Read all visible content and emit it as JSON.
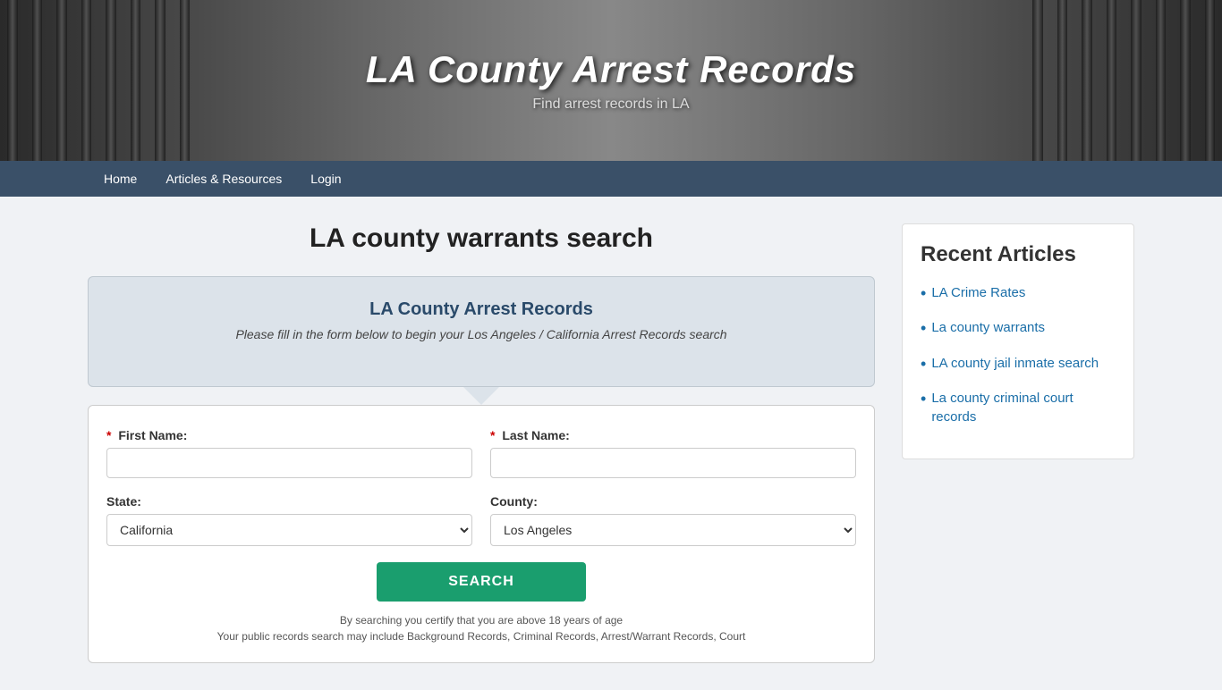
{
  "header": {
    "title": "LA County Arrest Records",
    "subtitle": "Find arrest records in LA"
  },
  "nav": {
    "items": [
      {
        "label": "Home",
        "href": "#"
      },
      {
        "label": "Articles & Resources",
        "href": "#"
      },
      {
        "label": "Login",
        "href": "#"
      }
    ]
  },
  "main": {
    "page_title": "LA county warrants search",
    "form_card": {
      "title": "LA County Arrest Records",
      "subtitle": "Please fill in the form below to begin your Los Angeles / California Arrest Records search"
    },
    "form": {
      "first_name_label": "First Name:",
      "last_name_label": "Last Name:",
      "state_label": "State:",
      "county_label": "County:",
      "state_default": "California",
      "county_default": "Los Angeles",
      "search_button": "SEARCH",
      "note_line1": "By searching you certify that you are above 18 years of age",
      "note_line2": "Your public records search may include Background Records, Criminal Records, Arrest/Warrant Records, Court"
    }
  },
  "sidebar": {
    "title": "Recent Articles",
    "articles": [
      {
        "label": "LA Crime Rates",
        "href": "#"
      },
      {
        "label": "La county warrants",
        "href": "#"
      },
      {
        "label": "LA county jail inmate search",
        "href": "#"
      },
      {
        "label": "La county criminal court records",
        "href": "#"
      }
    ]
  }
}
